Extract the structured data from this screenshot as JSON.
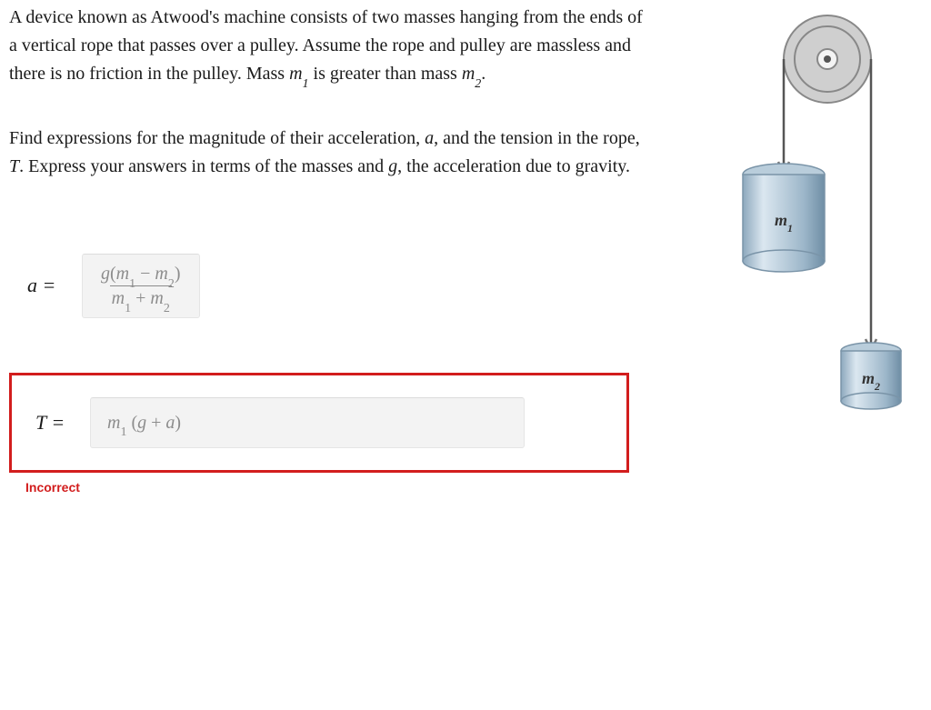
{
  "problem": {
    "para1_pre": "A device known as Atwood's machine consists of two masses hanging from the ends of a vertical rope that passes over a pulley. Assume the rope and pulley are massless and there is no friction in the pulley. Mass ",
    "m1": "m",
    "m1_sub": "1",
    "para1_mid": " is greater than mass ",
    "m2": "m",
    "m2_sub": "2",
    "para1_post": ".",
    "para2_pre": "Find expressions for the magnitude of their acceleration, ",
    "a": "a",
    "para2_mid1": ", and the tension in the rope, ",
    "T": "T",
    "para2_mid2": ". Express your answers in terms of the masses and ",
    "g": "g",
    "para2_post": ", the acceleration due to gravity."
  },
  "answers": {
    "a_lhs": "a =",
    "a_num_g": "g",
    "a_num_open": "(",
    "a_num_m1": "m",
    "a_num_m1s": "1",
    "a_num_minus": " − ",
    "a_num_m2": "m",
    "a_num_m2s": "2",
    "a_num_close": ")",
    "a_den_m1": "m",
    "a_den_m1s": "1",
    "a_den_plus": " + ",
    "a_den_m2": "m",
    "a_den_m2s": "2",
    "T_lhs": "T =",
    "T_m1": "m",
    "T_m1s": "1",
    "T_open": " (",
    "T_g": "g",
    "T_plus": " + ",
    "T_a": "a",
    "T_close": ")"
  },
  "feedback": {
    "incorrect": "Incorrect"
  },
  "figure": {
    "m1_label": "m₁",
    "m2_label": "m₂"
  }
}
